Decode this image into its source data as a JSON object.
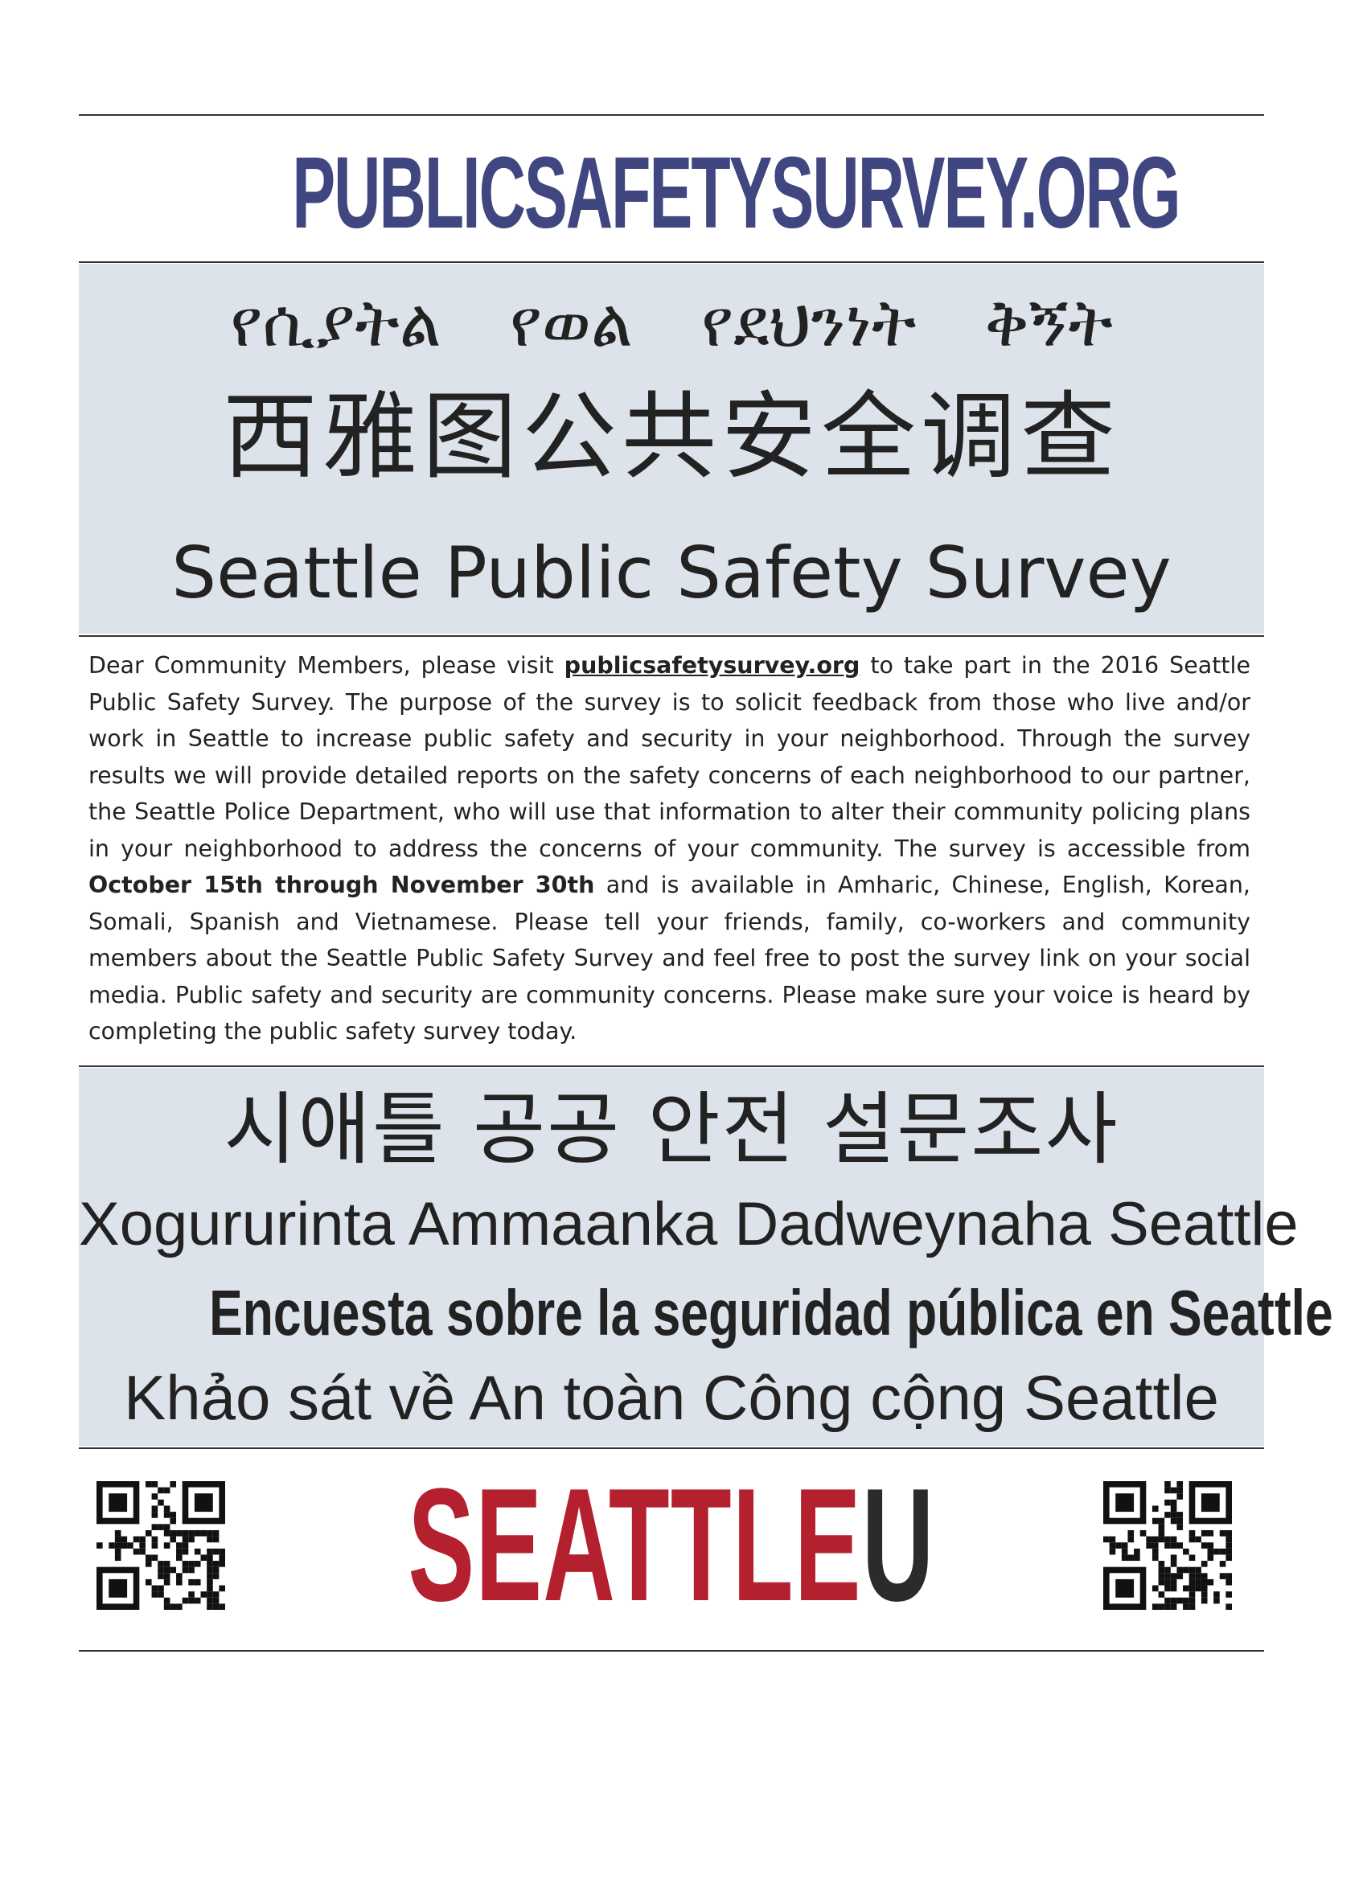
{
  "headline": "PUBLICSAFETYSURVEY.ORG",
  "amharic_words": [
    "የሲያትል",
    "የወል",
    "የደህንነት",
    "ቅኝት"
  ],
  "chinese_title": "西雅图公共安全调查",
  "english_title": "Seattle Public Safety Survey",
  "body": {
    "intro": "Dear Community Members, please visit ",
    "link": "publicsafetysurvey.org",
    "part2": " to take part in the 2016 Seattle Public Safety Survey. The purpose of the survey is to solicit feedback from those who live and/or work in Seattle to increase public safety and security in your neighborhood. Through the survey results we will provide detailed reports on the safety concerns of each neighborhood to our partner, the Seattle Police Department, who will use that information to alter their community policing plans in your neighborhood to address the concerns of your community. The survey is accessible from ",
    "dates": "October 15th through November 30th",
    "part3": " and is available in Amharic, Chinese, English, Korean, Somali, Spanish and Vietnamese. Please tell your friends, family, co-workers and community members about the Seattle Public Safety Survey and feel free to post the survey link on your social media. Public safety and security are community concerns. Please make sure your voice is heard by completing the public safety survey today."
  },
  "korean_title": "시애틀 공공 안전 설문조사",
  "somali_title": "Xogururinta Ammaanka Dadweynaha Seattle",
  "spanish_title": "Encuesta sobre la seguridad pública en Seattle",
  "vietnamese_title": "Khảo sát về An toàn Công cộng Seattle",
  "logo": {
    "main": "SEATTLE",
    "letter": "U"
  },
  "colors": {
    "headline": "#3f4680",
    "logo_red": "#b5202e",
    "panel": "#dde3ea"
  }
}
